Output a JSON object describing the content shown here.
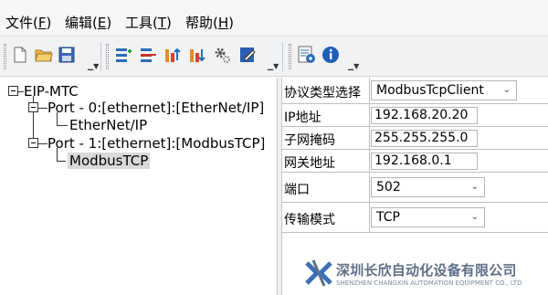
{
  "menubar": {
    "items": [
      {
        "label": "文件(",
        "key": "F",
        "suffix": ")"
      },
      {
        "label": "编辑(",
        "key": "E",
        "suffix": ")"
      },
      {
        "label": "工具(",
        "key": "T",
        "suffix": ")"
      },
      {
        "label": "帮助(",
        "key": "H",
        "suffix": ")"
      }
    ]
  },
  "toolbar": {
    "icons": [
      "new-file-icon",
      "open-folder-icon",
      "save-icon",
      "add-device-icon",
      "remove-device-icon",
      "upload-icon",
      "download-icon",
      "settings-icon",
      "edit-icon",
      "config-icon",
      "info-icon"
    ]
  },
  "tree": {
    "root": "EIP-MTC",
    "port0": "Port - 0:[ethernet]:[EtherNet/IP]",
    "port0_child": "EtherNet/IP",
    "port1": "Port - 1:[ethernet]:[ModbusTCP]",
    "port1_child": "ModbusTCP"
  },
  "properties": {
    "protocol_label": "协议类型选择",
    "protocol_value": "ModbusTcpClient",
    "ip_label": "IP地址",
    "ip_value": "192.168.20.20",
    "mask_label": "子网掩码",
    "mask_value": "255.255.255.0",
    "gateway_label": "网关地址",
    "gateway_value": "192.168.0.1",
    "port_label": "端口",
    "port_value": "502",
    "mode_label": "传输模式",
    "mode_value": "TCP"
  },
  "watermark": {
    "cn": "深圳长欣自动化设备有限公司",
    "en": "SHENZHEN CHANGXIN AUTOMATION EQUIPMENT CO., LTD"
  },
  "colors": {
    "selected_bg": "#d9d9d9",
    "watermark": "#5f6f86"
  }
}
